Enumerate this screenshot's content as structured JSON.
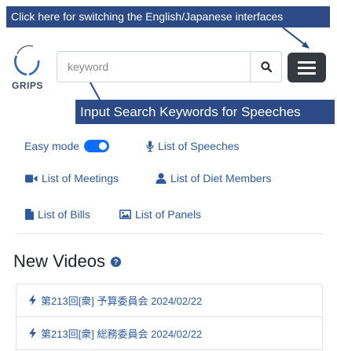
{
  "annotations": {
    "language_tip": "Click here for switching the English/Japanese interfaces",
    "search_tip": "Input Search Keywords for Speeches"
  },
  "logo": {
    "text": "GRIPS"
  },
  "search": {
    "placeholder": "keyword",
    "value": ""
  },
  "icons": {
    "search": "search-icon",
    "menu": "hamburger-menu-icon",
    "speeches": "microphone-icon",
    "meetings": "video-camera-icon",
    "members": "user-icon",
    "bills": "file-icon",
    "panels": "image-icon",
    "info": "question-circle-icon",
    "video": "bolt-icon"
  },
  "nav": {
    "easy_mode": {
      "label": "Easy mode",
      "enabled": true
    },
    "speeches": "List of Speeches",
    "meetings": "List of Meetings",
    "members": "List of Diet Members",
    "bills": "List of Bills",
    "panels": "List of Panels"
  },
  "new_videos": {
    "heading": "New Videos",
    "items": [
      {
        "label": "第213回[衆] 予算委員会 2024/02/22"
      },
      {
        "label": "第213回[衆] 総務委員会 2024/02/22"
      }
    ]
  },
  "colors": {
    "annotation_bg": "#2b4a86",
    "link": "#2c5aa0",
    "toggle": "#0d6efd",
    "menu_button": "#343a40"
  }
}
